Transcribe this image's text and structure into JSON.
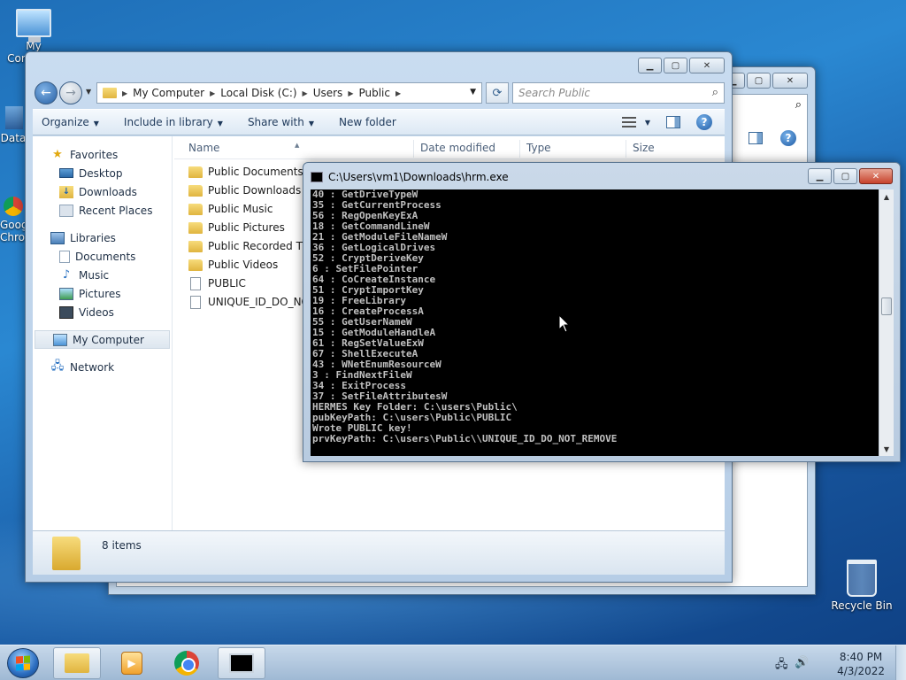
{
  "desktop": {
    "icons": {
      "computer": "My Computer",
      "data": "Data",
      "chrome": "Google Chrome",
      "recycle_bin": "Recycle Bin"
    }
  },
  "explorer": {
    "breadcrumb": [
      "My Computer",
      "Local Disk (C:)",
      "Users",
      "Public"
    ],
    "search_placeholder": "Search Public",
    "toolbar": {
      "organize": "Organize",
      "include_in_library": "Include in library",
      "share_with": "Share with",
      "new_folder": "New folder"
    },
    "nav": {
      "favorites": "Favorites",
      "desktop": "Desktop",
      "downloads": "Downloads",
      "recent_places": "Recent Places",
      "libraries": "Libraries",
      "documents": "Documents",
      "music": "Music",
      "pictures": "Pictures",
      "videos": "Videos",
      "my_computer": "My Computer",
      "network": "Network"
    },
    "columns": {
      "name": "Name",
      "date_modified": "Date modified",
      "type": "Type",
      "size": "Size"
    },
    "files": [
      {
        "name": "Public Documents",
        "kind": "folder"
      },
      {
        "name": "Public Downloads",
        "kind": "folder"
      },
      {
        "name": "Public Music",
        "kind": "folder"
      },
      {
        "name": "Public Pictures",
        "kind": "folder"
      },
      {
        "name": "Public Recorded TV",
        "kind": "folder"
      },
      {
        "name": "Public Videos",
        "kind": "folder"
      },
      {
        "name": "PUBLIC",
        "kind": "file"
      },
      {
        "name": "UNIQUE_ID_DO_NOT_REMOVE",
        "kind": "file"
      }
    ],
    "status": "8 items"
  },
  "console": {
    "title": "C:\\Users\\vm1\\Downloads\\hrm.exe",
    "lines": [
      "40 : GetDriveTypeW",
      "35 : GetCurrentProcess",
      "56 : RegOpenKeyExA",
      "18 : GetCommandLineW",
      "21 : GetModuleFileNameW",
      "36 : GetLogicalDrives",
      "52 : CryptDeriveKey",
      "6 : SetFilePointer",
      "64 : CoCreateInstance",
      "51 : CryptImportKey",
      "19 : FreeLibrary",
      "16 : CreateProcessA",
      "55 : GetUserNameW",
      "15 : GetModuleHandleA",
      "61 : RegSetValueExW",
      "67 : ShellExecuteA",
      "43 : WNetEnumResourceW",
      "3 : FindNextFileW",
      "34 : ExitProcess",
      "37 : SetFileAttributesW",
      "HERMES Key Folder: C:\\users\\Public\\",
      "pubKeyPath: C:\\users\\Public\\PUBLIC",
      "Wrote PUBLIC key!",
      "prvKeyPath: C:\\users\\Public\\\\UNIQUE_ID_DO_NOT_REMOVE"
    ]
  },
  "taskbar": {
    "time": "8:40 PM",
    "date": "4/3/2022"
  },
  "colors": {
    "console_bg": "#000000",
    "console_text": "#c0c0c0",
    "accent": "#2a88d2"
  }
}
